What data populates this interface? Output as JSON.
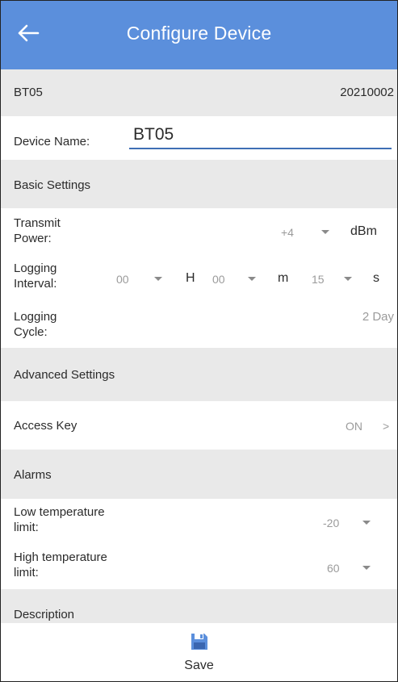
{
  "appbar": {
    "title": "Configure Device"
  },
  "device": {
    "code": "BT05",
    "serial": "20210002"
  },
  "device_name": {
    "label": "Device Name:",
    "value": "BT05"
  },
  "basic_settings": {
    "header": "Basic Settings",
    "transmit_power": {
      "label_line1": "Transmit",
      "label_line2": "Power:",
      "value": "+4",
      "unit": "dBm"
    },
    "logging_interval": {
      "label_line1": "Logging",
      "label_line2": "Interval:",
      "hours": "00",
      "hours_unit": "H",
      "minutes": "00",
      "minutes_unit": "m",
      "seconds": "15",
      "seconds_unit": "s"
    },
    "logging_cycle": {
      "label_line1": "Logging",
      "label_line2": "Cycle:",
      "value": "2 Day"
    }
  },
  "advanced_settings": {
    "header": "Advanced Settings",
    "access_key": {
      "label": "Access Key",
      "value": "ON",
      "chevron": ">"
    }
  },
  "alarms": {
    "header": "Alarms",
    "low_temp": {
      "label_line1": "Low temperature",
      "label_line2": "limit:",
      "value": "-20"
    },
    "high_temp": {
      "label_line1": "High temperature",
      "label_line2": "limit:",
      "value": "60"
    }
  },
  "description": {
    "header": "Description"
  },
  "footer": {
    "save_label": "Save",
    "icon": "floppy-disk-icon",
    "accent": "#5b8fdc"
  },
  "colors": {
    "appbar": "#5b8fdc",
    "section_bg": "#e9e9e9",
    "underline": "#3f6fb5"
  }
}
